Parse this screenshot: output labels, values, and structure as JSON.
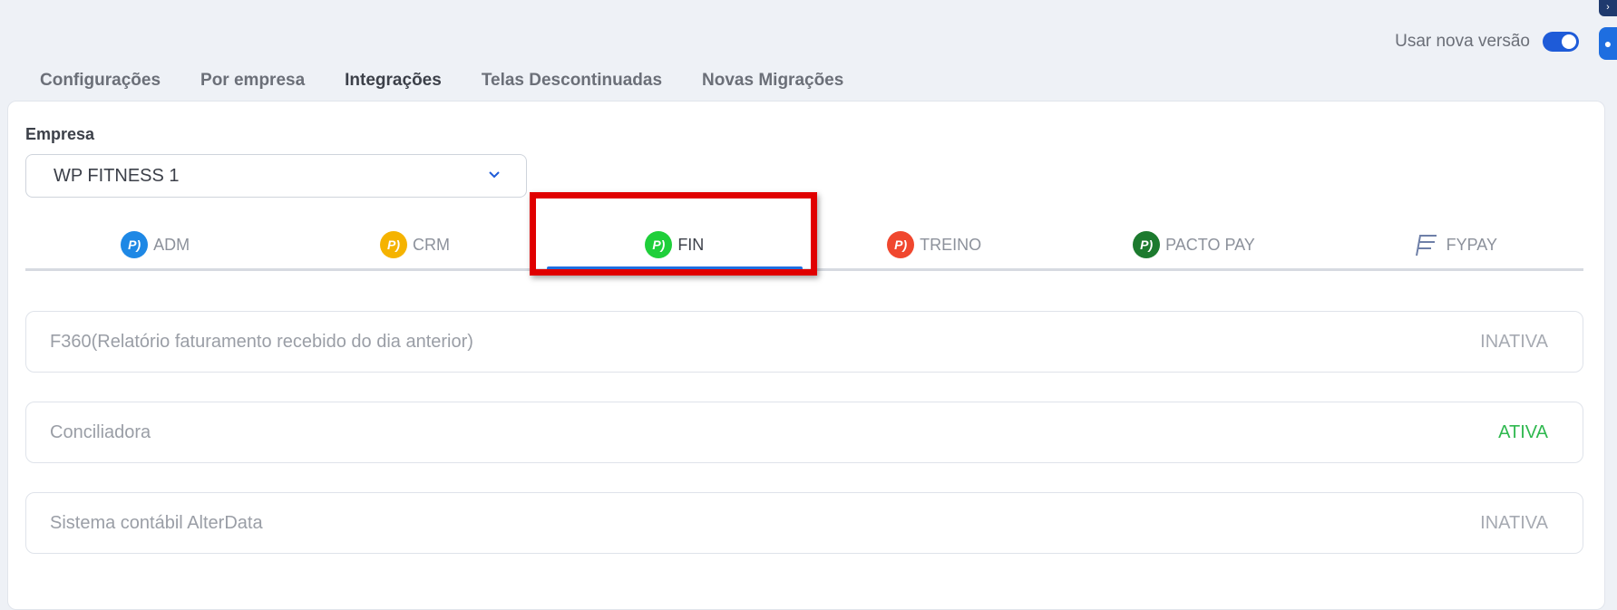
{
  "header": {
    "toggle_label": "Usar nova versão",
    "toggle_on": true
  },
  "page_tabs": [
    {
      "label": "Configurações",
      "active": false
    },
    {
      "label": "Por empresa",
      "active": false
    },
    {
      "label": "Integrações",
      "active": true
    },
    {
      "label": "Telas Descontinuadas",
      "active": false
    },
    {
      "label": "Novas Migrações",
      "active": false
    }
  ],
  "empresa": {
    "label": "Empresa",
    "selected": "WP FITNESS 1"
  },
  "modules": [
    {
      "label": "ADM",
      "color": "#1e88e5",
      "icon": "pacto-adm-icon",
      "active": false
    },
    {
      "label": "CRM",
      "color": "#f5b300",
      "icon": "pacto-crm-icon",
      "active": false
    },
    {
      "label": "FIN",
      "color": "#1fcf3a",
      "icon": "pacto-fin-icon",
      "active": true
    },
    {
      "label": "TREINO",
      "color": "#f0472e",
      "icon": "pacto-treino-icon",
      "active": false
    },
    {
      "label": "PACTO PAY",
      "color": "#1c7a2e",
      "icon": "pacto-pay-icon",
      "active": false
    },
    {
      "label": "FYPAY",
      "color": "#6e7fa8",
      "icon": "fypay-icon",
      "active": false
    }
  ],
  "integrations": [
    {
      "name": "F360(Relatório faturamento recebido do dia anterior)",
      "status": "INATIVA",
      "active": false
    },
    {
      "name": "Conciliadora",
      "status": "ATIVA",
      "active": true
    },
    {
      "name": "Sistema contábil AlterData",
      "status": "INATIVA",
      "active": false
    }
  ],
  "colors": {
    "accent": "#1e5bd8",
    "highlight": "#e00000",
    "status_active": "#2fb84f",
    "status_inactive": "#a6aab2"
  }
}
